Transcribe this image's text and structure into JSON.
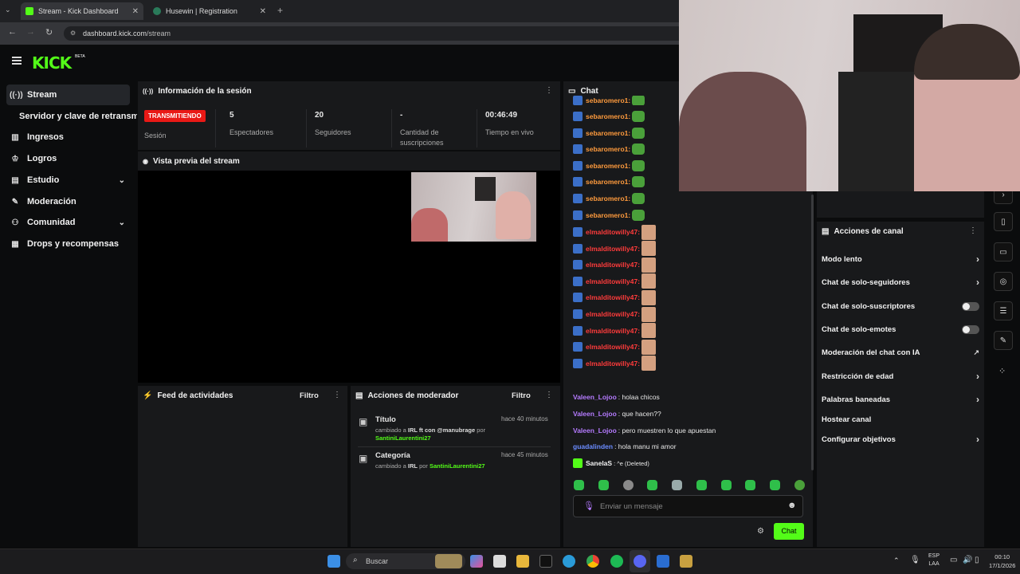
{
  "browser": {
    "tabs": [
      {
        "title": "Stream - Kick Dashboard",
        "active": true
      },
      {
        "title": "Husewin | Registration",
        "active": false
      }
    ],
    "url_host": "dashboard.kick.com",
    "url_path": "/stream"
  },
  "brand": {
    "logo": "KICK",
    "badge": "BETA",
    "accent": "#53fc18"
  },
  "sidebar": {
    "items": [
      {
        "label": "Stream",
        "icon": "broadcast-icon"
      },
      {
        "label": "Servidor y clave de retransm",
        "icon": ""
      },
      {
        "label": "Ingresos",
        "icon": "chart-icon"
      },
      {
        "label": "Logros",
        "icon": "trophy-icon"
      },
      {
        "label": "Estudio",
        "icon": "studio-icon"
      },
      {
        "label": "Moderación",
        "icon": "wrench-icon"
      },
      {
        "label": "Comunidad",
        "icon": "people-icon"
      },
      {
        "label": "Drops y recompensas",
        "icon": "gift-icon"
      }
    ]
  },
  "session": {
    "title": "Información de la sesión",
    "status": "TRANSMITIENDO",
    "status_label": "Sesión",
    "stats": [
      {
        "value": "5",
        "label": "Espectadores"
      },
      {
        "value": "20",
        "label": "Seguidores"
      },
      {
        "value": "-",
        "label": "Cantidad de suscripciones"
      },
      {
        "value": "00:46:49",
        "label": "Tiempo en vivo"
      }
    ]
  },
  "preview": {
    "title": "Vista previa del stream"
  },
  "activity": {
    "title": "Feed de actividades",
    "filter": "Filtro"
  },
  "modactions": {
    "title": "Acciones de moderador",
    "filter": "Filtro",
    "items": [
      {
        "heading": "Título",
        "time": "hace 40 minutos",
        "line1_prefix": "cambiado a",
        "line1_value": "IRL ft con @manubrage",
        "line1_suffix": "por",
        "user": "SantiniLaurentini27"
      },
      {
        "heading": "Categoría",
        "time": "hace 45 minutos",
        "line1_prefix": "cambiado a",
        "line1_value": "IRL",
        "line1_suffix": "por",
        "user": "SantiniLaurentini27"
      }
    ]
  },
  "chat": {
    "title": "Chat",
    "top_partial": "sebaromero1:",
    "frog_user": "sebaromero1:",
    "face_user": "elmalditowilly47:",
    "messages": [
      {
        "user": "Valeen_Lojoo",
        "text": ": holaa chicos",
        "color": "#b57bff"
      },
      {
        "user": "Valeen_Lojoo",
        "text": ": que hacen??",
        "color": "#b57bff"
      },
      {
        "user": "Valeen_Lojoo",
        "text": ": pero muestren lo que apuestan",
        "color": "#b57bff"
      },
      {
        "user": "guadalinden",
        "text": ": hola manu mi amor",
        "color": "#6b8cff"
      },
      {
        "user": "SanelaS",
        "text": ": ^e (Deleted)",
        "color": "#f2f2f2"
      }
    ],
    "input_placeholder": "Enviar un mensaje",
    "send_label": "Chat"
  },
  "channel_actions": {
    "title": "Acciones de canal",
    "items": [
      {
        "label": "Modo lento",
        "control": "chevron"
      },
      {
        "label": "Chat de solo-seguidores",
        "control": "chevron"
      },
      {
        "label": "Chat de solo-suscriptores",
        "control": "toggle"
      },
      {
        "label": "Chat de solo-emotes",
        "control": "toggle"
      },
      {
        "label": "Moderación del chat con IA",
        "control": "external"
      },
      {
        "label": "Restricción de edad",
        "control": "chevron"
      },
      {
        "label": "Palabras baneadas",
        "control": "chevron"
      },
      {
        "label": "Hostear canal",
        "control": "none"
      },
      {
        "label": "Configurar objetivos",
        "control": "chevron"
      }
    ]
  },
  "taskbar": {
    "search": "Buscar",
    "lang_top": "ESP",
    "lang_bottom": "LAA",
    "time": "00:10",
    "date": "17/1/2026"
  }
}
